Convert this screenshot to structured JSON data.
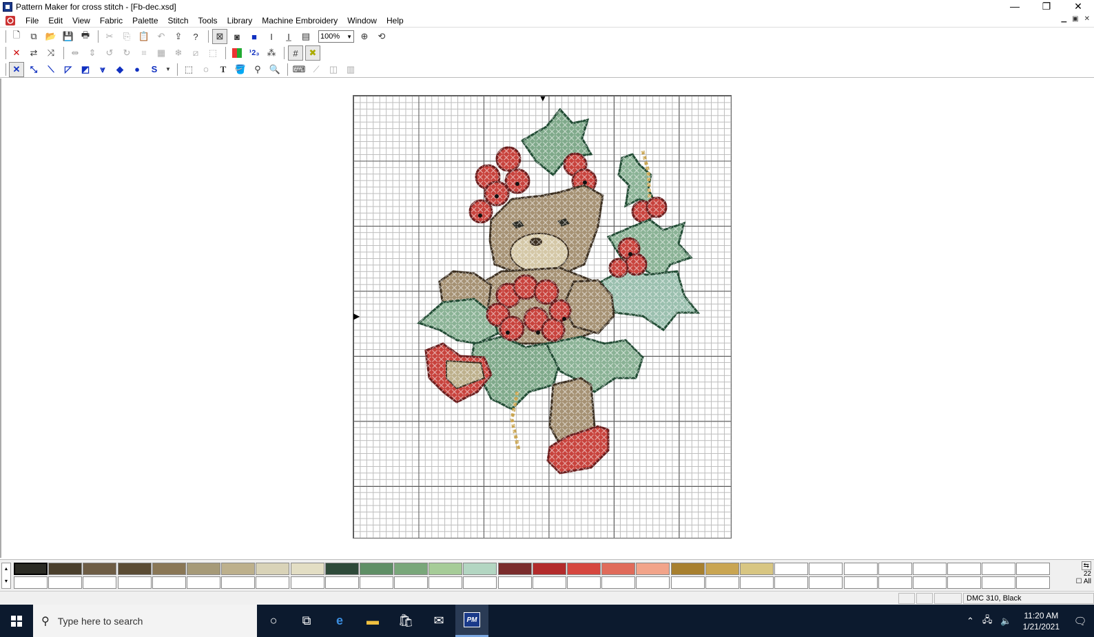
{
  "window": {
    "title": "Pattern Maker for cross stitch - [Fb-dec.xsd]",
    "minimize": "—",
    "restore": "❐",
    "close": "✕"
  },
  "menu": {
    "items": [
      "File",
      "Edit",
      "View",
      "Fabric",
      "Palette",
      "Stitch",
      "Tools",
      "Library",
      "Machine Embroidery",
      "Window",
      "Help"
    ]
  },
  "toolbar": {
    "zoom_value": "100%"
  },
  "palette": {
    "row1_colors": [
      "#2b2b24",
      "#4a3f2c",
      "#6e5d45",
      "#5b4c34",
      "#8a7756",
      "#a69a78",
      "#bdb08c",
      "#d9d3b8",
      "#e3dec4",
      "#2e4a39",
      "#5f8f66",
      "#79a77a",
      "#a6cc98",
      "#b3d6c2",
      "#7a2c2c",
      "#b32b2b",
      "#d6473f",
      "#e06b5a",
      "#f2a48a",
      "#a8802f",
      "#c9a552",
      "#d8c682",
      "#ffffff",
      "#ffffff",
      "#ffffff",
      "#ffffff",
      "#ffffff",
      "#ffffff",
      "#ffffff",
      "#ffffff"
    ],
    "right_label": "22",
    "all_label": "All"
  },
  "status": {
    "thread": "DMC  310, Black"
  },
  "taskbar": {
    "search_placeholder": "Type here to search",
    "time": "11:20 AM",
    "date": "1/21/2021"
  }
}
